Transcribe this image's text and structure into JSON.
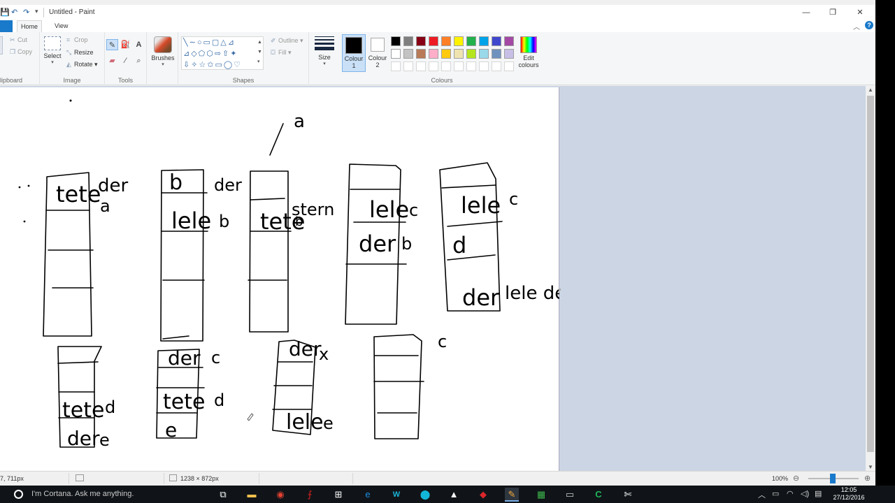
{
  "window": {
    "title": "Untitled - Paint",
    "minimize_glyph": "—",
    "restore_glyph": "❐",
    "close_glyph": "✕"
  },
  "quick_access": {
    "save_glyph": "💾",
    "undo_glyph": "↶",
    "redo_glyph": "↷",
    "dropdown_glyph": "▾"
  },
  "tabs": {
    "home": "Home",
    "view": "View",
    "collapse_glyph": "︿",
    "help_glyph": "?"
  },
  "ribbon": {
    "clipboard": {
      "cut": "Cut",
      "copy": "Copy",
      "group_label": "lipboard"
    },
    "image": {
      "select": "Select",
      "crop": "Crop",
      "resize": "Resize",
      "rotate": "Rotate",
      "group_label": "Image"
    },
    "tools": {
      "group_label": "Tools"
    },
    "brushes": {
      "label": "Brushes"
    },
    "shapes": {
      "outline": "Outline",
      "fill": "Fill",
      "group_label": "Shapes"
    },
    "size": {
      "label": "Size"
    },
    "colour1": {
      "label_line1": "Colour",
      "label_line2": "1"
    },
    "colour2": {
      "label_line1": "Colour",
      "label_line2": "2"
    },
    "colours": {
      "group_label": "Colours",
      "edit_line1": "Edit",
      "edit_line2": "colours"
    }
  },
  "palette_row1": [
    "#000000",
    "#7f7f7f",
    "#880015",
    "#ed1c24",
    "#ff7f27",
    "#fff200",
    "#22b14c",
    "#00a2e8",
    "#3f48cc",
    "#a349a4"
  ],
  "palette_row2": [
    "#ffffff",
    "#c3c3c3",
    "#b97a57",
    "#ffaec9",
    "#ffc90e",
    "#efe4b0",
    "#b5e61d",
    "#99d9ea",
    "#7092be",
    "#c8bfe7"
  ],
  "colours_state": {
    "colour1": "#000000",
    "colour2": "#ffffff"
  },
  "status": {
    "cursor_pos": "7, 711px",
    "canvas_size": "1238 × 872px",
    "zoom": "100%",
    "zoom_out_glyph": "⊖",
    "zoom_in_glyph": "⊕"
  },
  "taskbar": {
    "search_placeholder": "I'm Cortana. Ask me anything.",
    "time": "12:05",
    "date": "27/12/2016"
  },
  "drawing": {
    "handwriting": [
      "a",
      "tete",
      "der",
      "a",
      "b",
      "lele",
      "der",
      "b",
      "tete",
      "stern",
      "b",
      "lele",
      "c",
      "der",
      "b",
      "lele",
      "c",
      "d",
      "der",
      "lele der",
      "c",
      "tete",
      "d",
      "der",
      "e",
      "der",
      "c",
      "tete",
      "d",
      "e",
      "der",
      "x",
      "lele",
      "e"
    ]
  }
}
